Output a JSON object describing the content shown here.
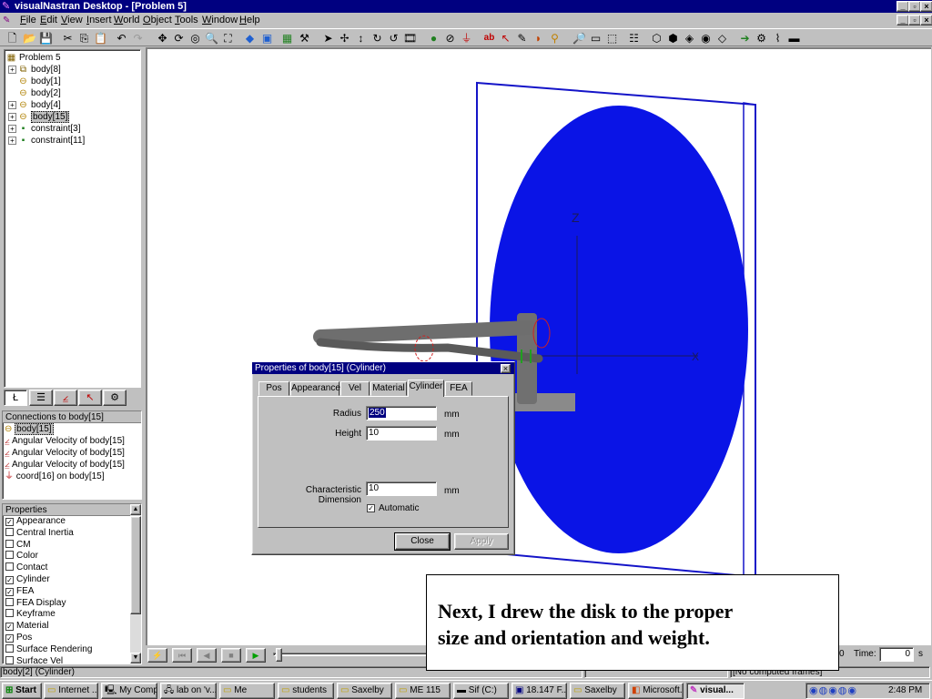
{
  "window": {
    "title": "visualNastran Desktop - [Problem 5]",
    "controls": [
      "_",
      "▫",
      "×"
    ],
    "mdi_controls": [
      "_",
      "▫",
      "×"
    ]
  },
  "menu": [
    "File",
    "Edit",
    "View",
    "Insert",
    "World",
    "Object",
    "Tools",
    "Window",
    "Help"
  ],
  "toolbar": {
    "icons": [
      "new-file-icon",
      "open-folder-icon",
      "save-icon",
      "cut-icon",
      "copy-icon",
      "paste-icon",
      "undo-icon",
      "redo-icon",
      "move-icon",
      "rotate-icon",
      "orbit-icon",
      "zoom-icon",
      "zoom-fit-icon",
      "render-icon",
      "frame-icon",
      "grid-icon",
      "tool-icon",
      "select-arrow-icon",
      "move-cross-icon",
      "vertical-move-icon",
      "spin-icon",
      "spin2-icon",
      "film-icon",
      "point-icon",
      "constraint-icon",
      "coord-icon",
      "text-icon",
      "curve-icon",
      "pencil-icon",
      "shape-icon",
      "link-icon",
      "zoom-window-icon",
      "frame-rect-icon",
      "frame-dash-icon",
      "align-icon",
      "box-icon",
      "box2-icon",
      "box3-icon",
      "box4-icon",
      "box5-icon",
      "arrow-right-icon",
      "gear-icon",
      "spring-icon",
      "bar-icon"
    ]
  },
  "tree": {
    "root": "Problem 5",
    "items": [
      {
        "label": "body[8]",
        "expander": "+",
        "icon": "assembly-icon"
      },
      {
        "label": "body[1]",
        "expander": "",
        "icon": "body-icon"
      },
      {
        "label": "body[2]",
        "expander": "",
        "icon": "body-icon"
      },
      {
        "label": "body[4]",
        "expander": "+",
        "icon": "body-icon"
      },
      {
        "label": "body[15]",
        "expander": "+",
        "icon": "body-icon",
        "selected": true
      },
      {
        "label": "constraint[3]",
        "expander": "+",
        "icon": "constraint-icon"
      },
      {
        "label": "constraint[11]",
        "expander": "+",
        "icon": "constraint-icon"
      }
    ],
    "tabs": [
      "Ł",
      "☰",
      "⦤",
      "↖",
      "⚙"
    ]
  },
  "connections": {
    "header": "Connections to body[15]",
    "items": [
      "body[15]",
      "Angular Velocity of body[15]",
      "Angular Velocity of body[15]",
      "Angular Velocity of body[15]",
      "coord[16] on body[15]"
    ]
  },
  "properties": {
    "header": "Properties",
    "items": [
      {
        "label": "Appearance",
        "checked": true
      },
      {
        "label": "Central Inertia",
        "checked": false
      },
      {
        "label": "CM",
        "checked": false
      },
      {
        "label": "Color",
        "checked": false
      },
      {
        "label": "Contact",
        "checked": false
      },
      {
        "label": "Cylinder",
        "checked": true
      },
      {
        "label": "FEA",
        "checked": true
      },
      {
        "label": "FEA Display",
        "checked": false
      },
      {
        "label": "Keyframe",
        "checked": false
      },
      {
        "label": "Material",
        "checked": true
      },
      {
        "label": "Pos",
        "checked": true
      },
      {
        "label": "Surface Rendering",
        "checked": false
      },
      {
        "label": "Surface Vel",
        "checked": false
      }
    ]
  },
  "dialog": {
    "title": "Properties of body[15] (Cylinder)",
    "close": "×",
    "tabs": [
      "Pos",
      "Appearance",
      "Vel",
      "Material",
      "Cylinder",
      "FEA"
    ],
    "active_tab": "Cylinder",
    "radius_label": "Radius",
    "radius_value": "250",
    "height_label": "Height",
    "height_value": "10",
    "char_dim_label": "Characteristic Dimension",
    "char_dim_value": "10",
    "unit": "mm",
    "automatic_label": "Automatic",
    "automatic_checked": true,
    "close_button": "Close",
    "apply_button": "Apply"
  },
  "playbar": {
    "time_frame_value": "0",
    "time_label": "Time:",
    "time_value": "0",
    "time_unit": "s"
  },
  "status": {
    "left": "body[2] (Cylinder)",
    "right": "[No computed frames]"
  },
  "taskbar": {
    "start": "Start",
    "tasks": [
      "Internet ...",
      "My Comp...",
      "lab on 'v...",
      "Me",
      "students",
      "Saxelby",
      "ME 115",
      "Sif (C:)",
      "18.147 F...",
      "Saxelby",
      "Microsoft...",
      "visual..."
    ],
    "active_task": "visual...",
    "clock": "2:48 PM"
  },
  "caption": {
    "line1": "Next, I drew the disk to the proper",
    "line2": "size and orientation and weight."
  },
  "colors": {
    "disk": "#0a14e6",
    "frame_outline": "#1414c8",
    "titlebar": "#000080",
    "shaft": "#6e6e6e",
    "axis": "#1a1a5a"
  }
}
